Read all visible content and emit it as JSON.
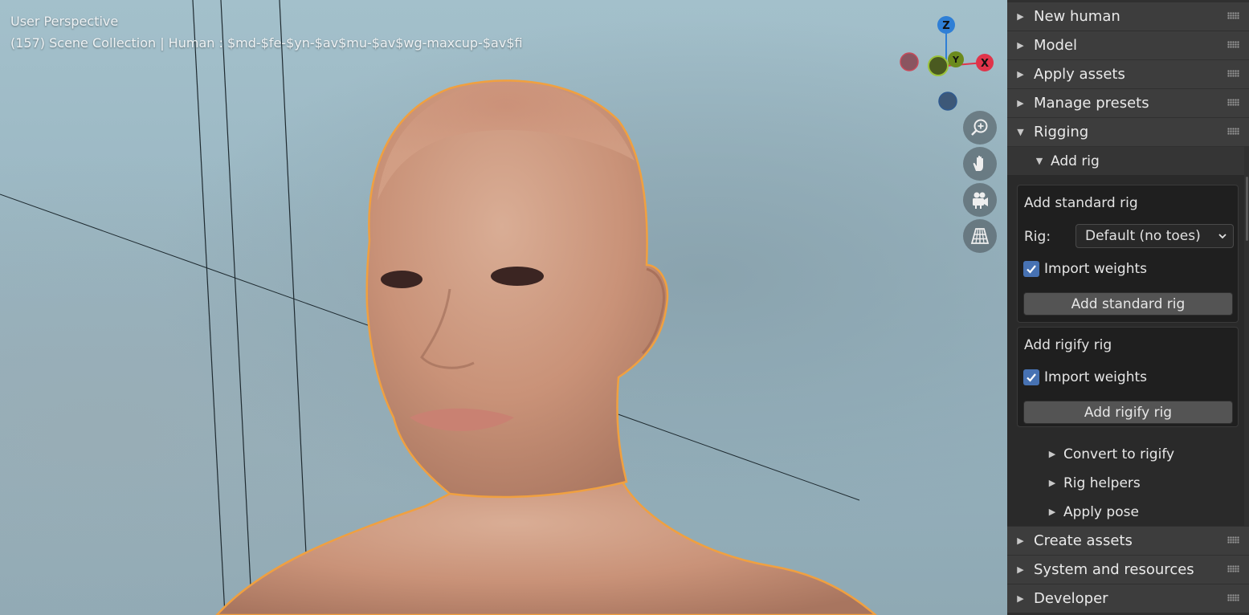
{
  "viewport": {
    "title": "User Perspective",
    "info": "(157) Scene Collection | Human : $md-$fe-$yn-$av$mu-$av$wg-maxcup-$av$fi",
    "gizmo": {
      "z": "Z",
      "y": "Y",
      "x": "X"
    },
    "nav_buttons": [
      "zoom-icon",
      "hand-pan-icon",
      "camera-icon",
      "grid-perspective-icon"
    ]
  },
  "panel": {
    "sections": [
      {
        "label": "New human",
        "expanded": false
      },
      {
        "label": "Model",
        "expanded": false
      },
      {
        "label": "Apply assets",
        "expanded": false
      },
      {
        "label": "Manage presets",
        "expanded": false
      },
      {
        "label": "Rigging",
        "expanded": true
      }
    ],
    "rigging": {
      "add_rig_label": "Add rig",
      "standard": {
        "title": "Add standard rig",
        "rig_label": "Rig:",
        "rig_value": "Default (no toes)",
        "import_weights": "Import weights",
        "import_checked": true,
        "button": "Add standard rig"
      },
      "rigify": {
        "title": "Add rigify rig",
        "import_weights": "Import weights",
        "import_checked": true,
        "button": "Add rigify rig"
      },
      "subsections": [
        {
          "label": "Convert to rigify"
        },
        {
          "label": "Rig helpers"
        },
        {
          "label": "Apply pose"
        }
      ]
    },
    "bottom_sections": [
      {
        "label": "Create assets"
      },
      {
        "label": "System and resources"
      },
      {
        "label": "Developer"
      }
    ]
  },
  "colors": {
    "accent_blue": "#4772b3",
    "selection_outline": "#f0a040",
    "axis_x": "#e0344a",
    "axis_y": "#7a9b1e",
    "axis_z": "#2f7fd6"
  }
}
